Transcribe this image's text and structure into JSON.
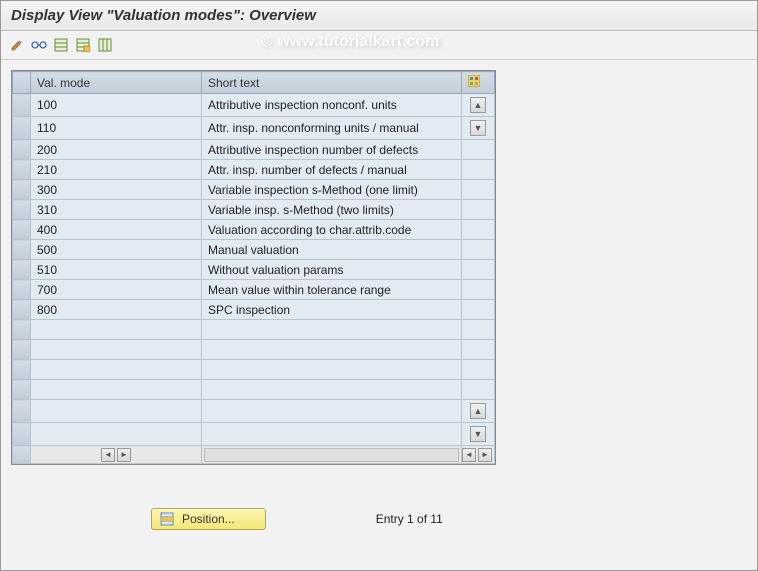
{
  "title": "Display View \"Valuation modes\": Overview",
  "watermark": "© www.tutorialkart.com",
  "columns": {
    "valmode": "Val. mode",
    "shorttext": "Short text"
  },
  "rows": [
    {
      "valmode": "100",
      "shorttext": "Attributive inspection nonconf. units"
    },
    {
      "valmode": "110",
      "shorttext": "Attr. insp. nonconforming units / manual"
    },
    {
      "valmode": "200",
      "shorttext": "Attributive inspection number of defects"
    },
    {
      "valmode": "210",
      "shorttext": "Attr. insp. number of defects / manual"
    },
    {
      "valmode": "300",
      "shorttext": "Variable inspection s-Method (one limit)"
    },
    {
      "valmode": "310",
      "shorttext": "Variable insp. s-Method (two limits)"
    },
    {
      "valmode": "400",
      "shorttext": "Valuation according to char.attrib.code"
    },
    {
      "valmode": "500",
      "shorttext": "Manual valuation"
    },
    {
      "valmode": "510",
      "shorttext": "Without valuation params"
    },
    {
      "valmode": "700",
      "shorttext": "Mean value within tolerance range"
    },
    {
      "valmode": "800",
      "shorttext": "SPC inspection"
    }
  ],
  "emptyRows": 6,
  "positionButton": "Position...",
  "entryText": "Entry 1 of 11"
}
